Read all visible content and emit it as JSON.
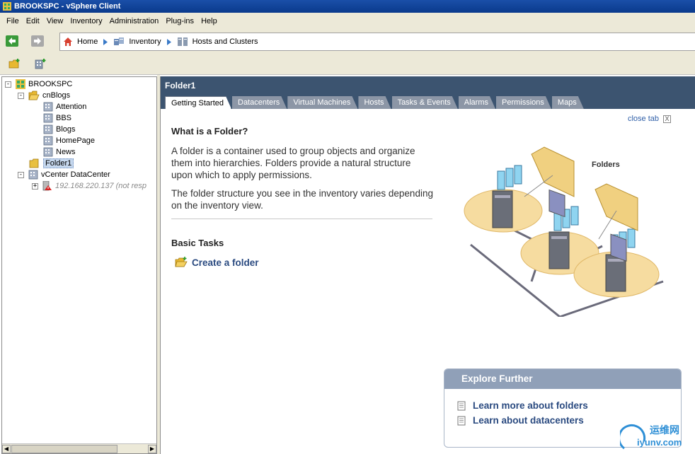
{
  "window": {
    "title": "BROOKSPC - vSphere Client"
  },
  "menu": {
    "items": [
      "File",
      "Edit",
      "View",
      "Inventory",
      "Administration",
      "Plug-ins",
      "Help"
    ]
  },
  "breadcrumb": {
    "items": [
      "Home",
      "Inventory",
      "Hosts and Clusters"
    ]
  },
  "tree": {
    "nodes": [
      {
        "label": "BROOKSPC",
        "expander": "-"
      },
      {
        "label": "cnBlogs",
        "expander": "-"
      },
      {
        "label": "Attention"
      },
      {
        "label": "BBS"
      },
      {
        "label": "Blogs"
      },
      {
        "label": "HomePage"
      },
      {
        "label": "News"
      },
      {
        "label": "Folder1",
        "selected": true
      },
      {
        "label": "vCenter DataCenter",
        "expander": "-"
      },
      {
        "label": "192.168.220.137 (not resp",
        "expander": "+"
      }
    ]
  },
  "main": {
    "title": "Folder1",
    "tabs": [
      "Getting Started",
      "Datacenters",
      "Virtual Machines",
      "Hosts",
      "Tasks & Events",
      "Alarms",
      "Permissions",
      "Maps"
    ],
    "active_tab": "Getting Started",
    "close_tab_label": "close tab",
    "close_tab_x": "X",
    "heading": "What is a Folder?",
    "paragraph1": "A folder is a container used to group objects and organize them into hierarchies. Folders provide a natural structure upon which to apply permissions.",
    "paragraph2": "The folder structure you see in the inventory varies depending on the inventory view.",
    "basic_tasks_heading": "Basic Tasks",
    "create_folder_label": "Create a folder",
    "illustration_label": "Folders"
  },
  "explore": {
    "title": "Explore Further",
    "links": [
      "Learn more about folders",
      "Learn about datacenters"
    ]
  },
  "watermark": {
    "line1": "运维网",
    "line2": "iyunv.com"
  },
  "colors": {
    "header_bg": "#3c5470",
    "link": "#2a4a80",
    "accent_blue": "#2f5fa8"
  }
}
